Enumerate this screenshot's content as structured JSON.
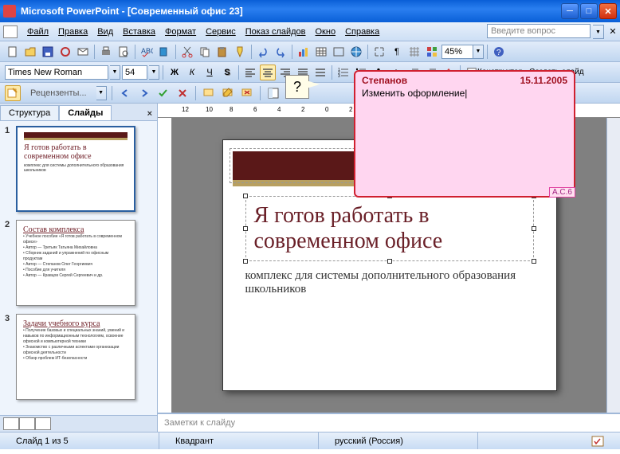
{
  "title": "Microsoft PowerPoint - [Современный офис 23]",
  "menu": {
    "file": "Файл",
    "edit": "Правка",
    "view": "Вид",
    "insert": "Вставка",
    "format": "Формат",
    "tools": "Сервис",
    "slideshow": "Показ слайдов",
    "window": "Окно",
    "help": "Справка"
  },
  "help_placeholder": "Введите вопрос",
  "zoom": "45%",
  "font": {
    "name": "Times New Roman",
    "size": "54"
  },
  "design_btn": "Конструктор",
  "newslide_btn": "Создать слайд",
  "reviewers": "Рецензенты...",
  "tabs": {
    "outline": "Структура",
    "slides": "Слайды"
  },
  "thumbs": [
    {
      "n": "1",
      "title": "Я готов работать в современном офисе",
      "sub": "комплекс для системы дополнительного образования школьников"
    },
    {
      "n": "2",
      "title": "Состав комплекса",
      "items": [
        "Учебное пособие «Я готов работать в современном офисе»",
        "Автор — Третьяк Татьяна Михайловна",
        "Сборник заданий и упражнений по офисным продуктам",
        "Автор — Степанов Олег Георгиевич",
        "Пособие для учителя",
        "Автор — Кравцов Сергей Сергеевич и др."
      ]
    },
    {
      "n": "3",
      "title": "Задачи учебного курса",
      "items": [
        "Получение базовых и специальных знаний, умений и навыков по информационным технологиям, освоение офисной и компьютерной техники",
        "Знакомство с различными аспектами организации офисной деятельности",
        "Обзор проблем ИТ-безопасности"
      ]
    }
  ],
  "slide": {
    "title": "Я готов работать в современном офисе",
    "subtitle": "комплекс для системы дополнительного образования школьников"
  },
  "comment": {
    "author": "Степанов",
    "date": "15.11.2005",
    "text": "Изменить оформление",
    "tag": "А.С.6"
  },
  "notes_placeholder": "Заметки к слайду",
  "status": {
    "slide": "Слайд 1 из 5",
    "layout": "Квадрант",
    "lang": "русский (Россия)"
  }
}
